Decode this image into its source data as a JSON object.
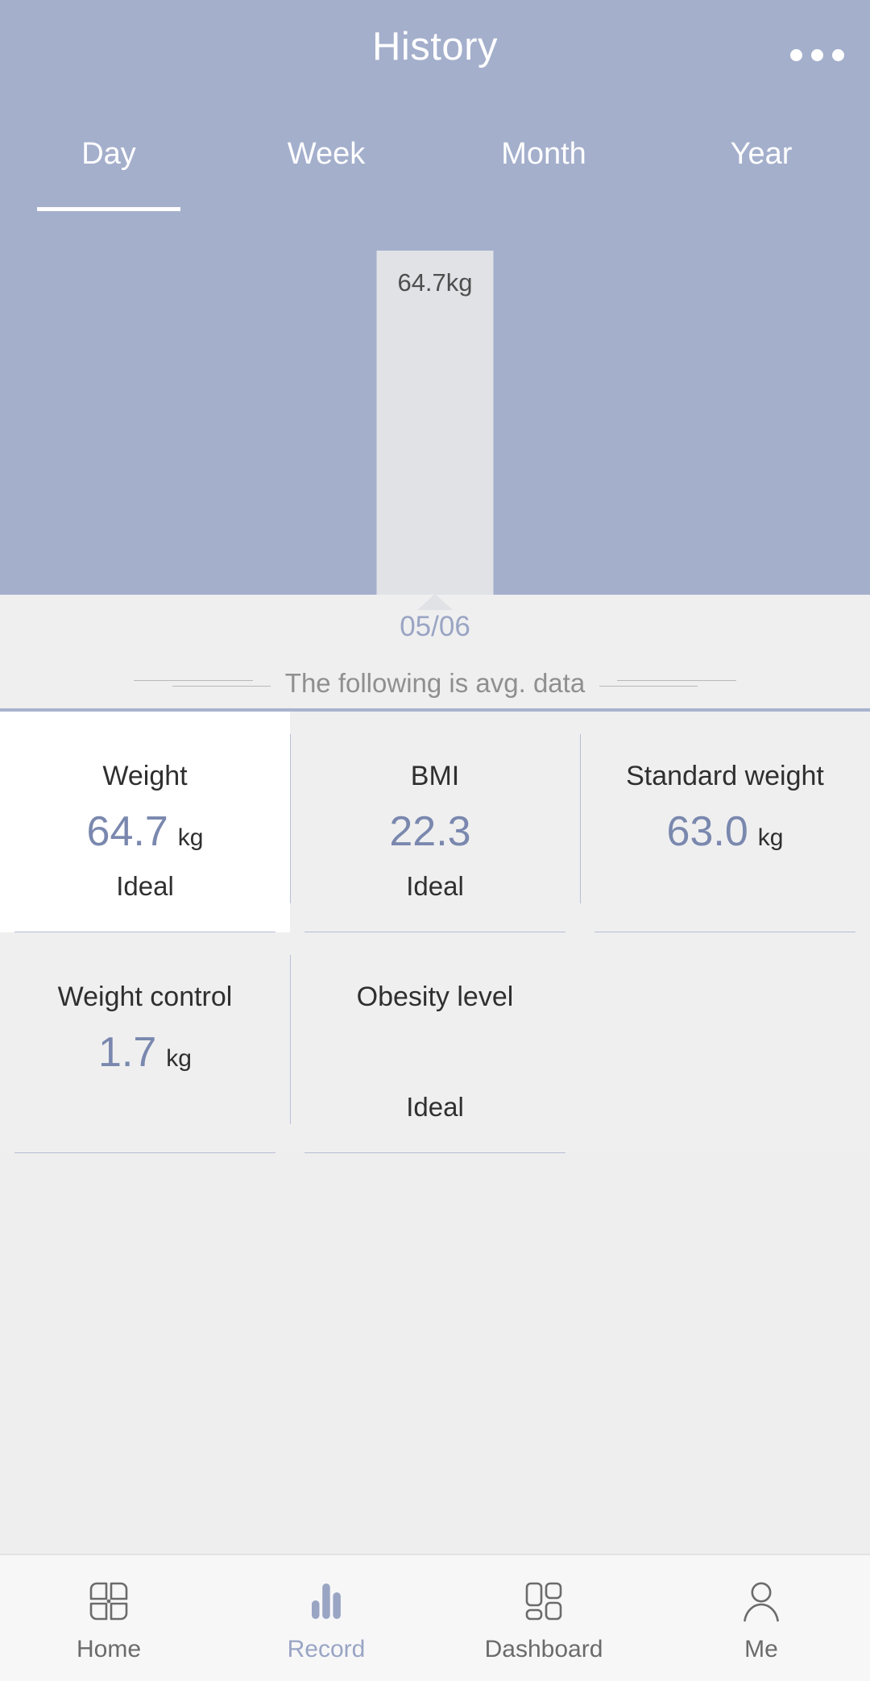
{
  "header": {
    "title": "History",
    "more_icon": "more-horizontal-icon",
    "background_color": "#a4afcc",
    "tabs": [
      {
        "label": "Day",
        "active": true
      },
      {
        "label": "Week",
        "active": false
      },
      {
        "label": "Month",
        "active": false
      },
      {
        "label": "Year",
        "active": false
      }
    ]
  },
  "chart_data": {
    "type": "bar",
    "title": "History",
    "categories": [
      "05/06"
    ],
    "values": [
      64.7
    ],
    "value_labels": [
      "64.7kg"
    ],
    "unit": "kg",
    "series": [
      {
        "name": "Weight",
        "values": [
          64.7
        ]
      }
    ],
    "xlabel": "",
    "ylabel": "",
    "grid": false,
    "legend": "none",
    "bar_color": "#e0e2e6",
    "plot_background": "#a4afcc",
    "selected_category": "05/06"
  },
  "info_strip": {
    "date": "05/06",
    "avg_note": "The following is avg. data"
  },
  "stats": {
    "rows": [
      [
        {
          "title": "Weight",
          "value": "64.7",
          "unit": "kg",
          "status": "Ideal",
          "highlight": true
        },
        {
          "title": "BMI",
          "value": "22.3",
          "unit": "",
          "status": "Ideal",
          "highlight": false
        },
        {
          "title": "Standard weight",
          "value": "63.0",
          "unit": "kg",
          "status": "",
          "highlight": false
        }
      ],
      [
        {
          "title": "Weight control",
          "value": "1.7",
          "unit": "kg",
          "status": "",
          "highlight": false
        },
        {
          "title": "Obesity level",
          "value": "",
          "unit": "",
          "status": "Ideal",
          "highlight": false
        },
        {
          "title": "",
          "value": "",
          "unit": "",
          "status": "",
          "highlight": false
        }
      ]
    ],
    "value_color": "#7a88ae"
  },
  "bottom_nav": {
    "items": [
      {
        "label": "Home",
        "icon": "grid-four-panel-icon",
        "active": false
      },
      {
        "label": "Record",
        "icon": "bar-chart-icon",
        "active": true
      },
      {
        "label": "Dashboard",
        "icon": "dashboard-tiles-icon",
        "active": false
      },
      {
        "label": "Me",
        "icon": "person-icon",
        "active": false
      }
    ],
    "active_color": "#9aa5c4",
    "inactive_color": "#6b6b6b"
  }
}
